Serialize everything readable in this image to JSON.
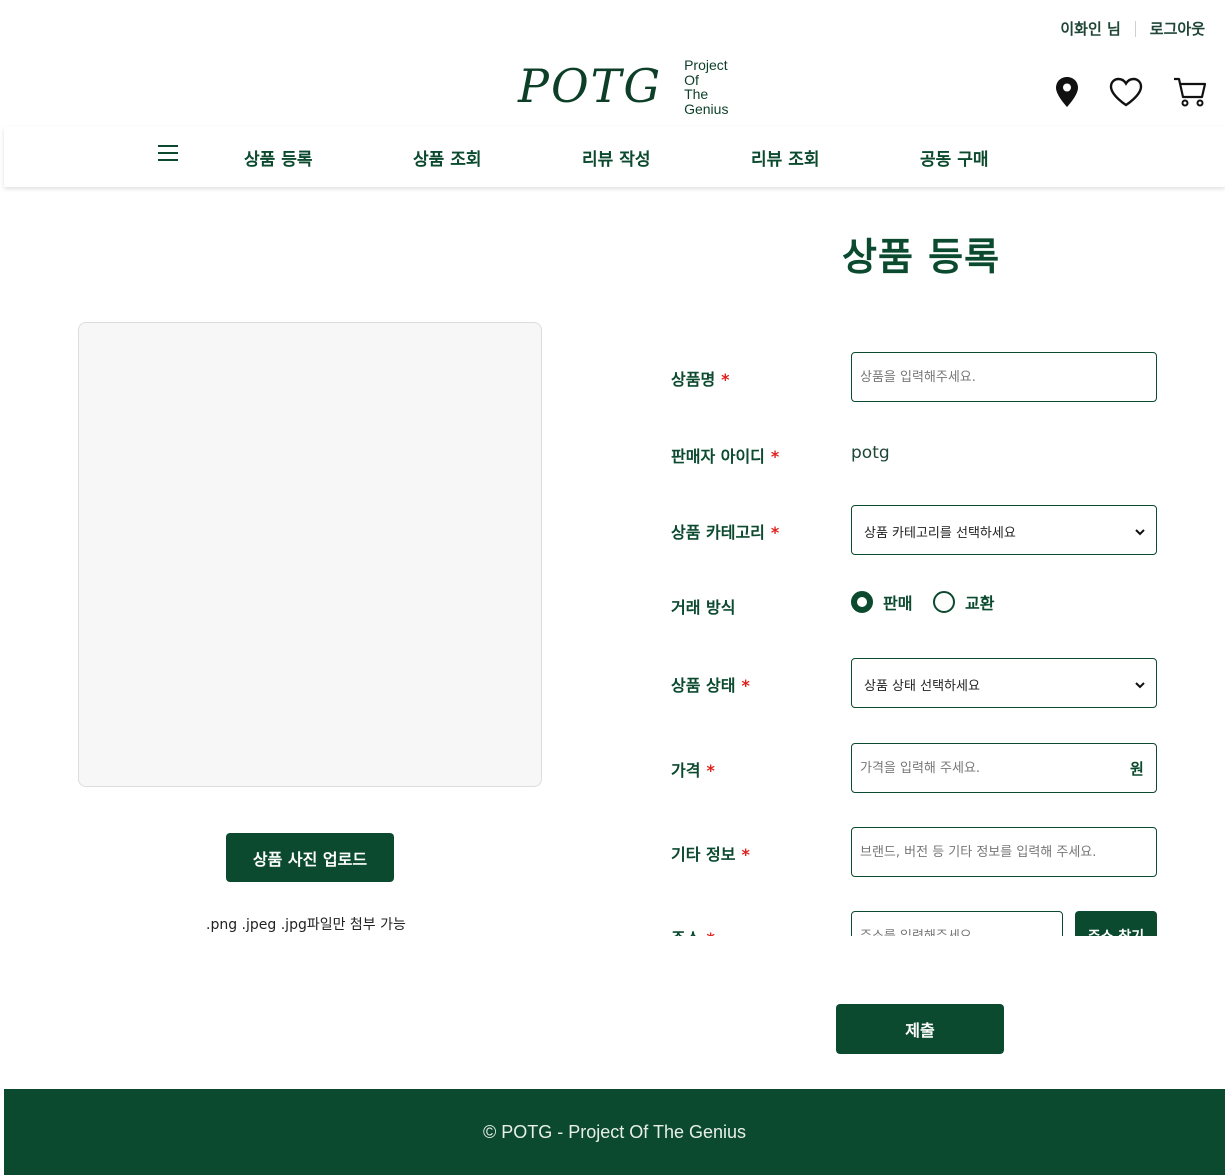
{
  "header": {
    "user_name": "이화인 님",
    "logout": "로그아웃",
    "logo_mark": "POTG",
    "logo_sub": [
      "Project",
      "Of",
      "The",
      "Genius"
    ]
  },
  "icons": {
    "location": "map-pin-icon",
    "wishlist": "heart-icon",
    "cart": "cart-icon",
    "menu": "hamburger-menu-icon"
  },
  "nav": {
    "items": [
      "상품 등록",
      "상품 조회",
      "리뷰 작성",
      "리뷰 조회",
      "공동 구매"
    ]
  },
  "page": {
    "title": "상품 등록"
  },
  "upload": {
    "button": "상품 사진 업로드",
    "note": ".png .jpeg .jpg파일만 첨부 가능"
  },
  "form": {
    "required_mark": "*",
    "product_name": {
      "label": "상품명",
      "placeholder": "상품을 입력해주세요."
    },
    "seller_id": {
      "label": "판매자 아이디",
      "value": "potg"
    },
    "category": {
      "label": "상품 카테고리",
      "selected": "상품 카테고리를 선택하세요"
    },
    "trade_method": {
      "label": "거래 방식",
      "options": [
        "판매",
        "교환"
      ],
      "selected": "판매"
    },
    "condition": {
      "label": "상품 상태",
      "selected": "상품 상태 선택하세요"
    },
    "price": {
      "label": "가격",
      "placeholder": "가격을 입력해 주세요.",
      "unit": "원"
    },
    "extra": {
      "label": "기타 정보",
      "placeholder": "브랜드, 버전 등 기타 정보를 입력해 주세요."
    },
    "address": {
      "label": "주소",
      "placeholder": "주소를 입력해주세요",
      "button": "주소 찾기"
    }
  },
  "submit": {
    "label": "제출"
  },
  "footer": {
    "text": "© POTG - Project Of The Genius"
  },
  "colors": {
    "primary": "#0b4a2e",
    "required": "#e0201b",
    "photo_bg": "#f7f7f7"
  }
}
